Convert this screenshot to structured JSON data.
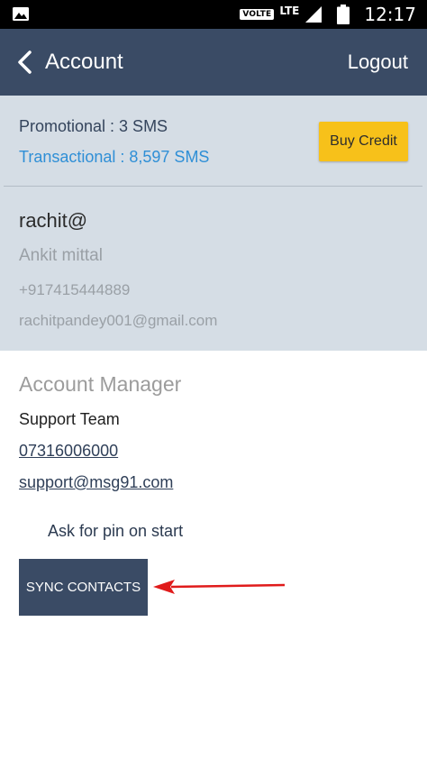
{
  "status_bar": {
    "volte_label": "VOLTE",
    "network_label": "LTE",
    "time": "12:17"
  },
  "app_bar": {
    "title": "Account",
    "logout_label": "Logout"
  },
  "credits": {
    "promotional": "Promotional : 3 SMS",
    "transactional": "Transactional : 8,597 SMS",
    "buy_credit_label": "Buy Credit"
  },
  "user": {
    "username": "rachit@",
    "full_name": "Ankit mittal",
    "phone": "+917415444889",
    "email": "rachitpandey001@gmail.com"
  },
  "account_manager": {
    "heading": "Account Manager",
    "name": "Support Team",
    "phone": "07316006000",
    "email": "support@msg91.com"
  },
  "settings": {
    "pin_label": "Ask for pin on start",
    "sync_contacts_label": "SYNC CONTACTS"
  },
  "colors": {
    "app_bar": "#3a4b65",
    "panel_bg": "#d5dde5",
    "accent_blue": "#2f8fd6",
    "buy_button": "#f7c11a",
    "annotation_arrow": "#e01b1b"
  }
}
